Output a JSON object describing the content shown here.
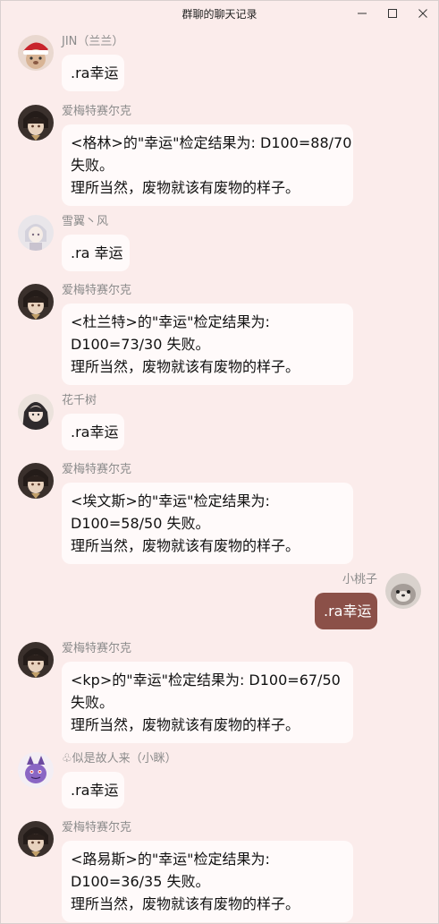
{
  "window": {
    "title": "群聊的聊天记录",
    "minimize_glyph": "—",
    "maximize_glyph": "☐",
    "close_glyph": "✕"
  },
  "messages": [
    {
      "sender": "JIN（兰兰）",
      "lines": [
        ".ra幸运"
      ],
      "side": "left",
      "avatar_icon": "santa-hat-avatar"
    },
    {
      "sender": "爱梅特赛尔克",
      "lines": [
        "<格林>的\"幸运\"检定结果为: D100=88/70",
        "失败。",
        "理所当然，废物就该有废物的样子。"
      ],
      "side": "left",
      "avatar_icon": "dark-character-avatar"
    },
    {
      "sender": "雪翼丶风",
      "lines": [
        ".ra 幸运"
      ],
      "side": "left",
      "avatar_icon": "light-character-avatar"
    },
    {
      "sender": "爱梅特赛尔克",
      "lines": [
        "<杜兰特>的\"幸运\"检定结果为:",
        "D100=73/30 失败。",
        "理所当然，废物就该有废物的样子。"
      ],
      "side": "left",
      "avatar_icon": "dark-character-avatar"
    },
    {
      "sender": "花千树",
      "lines": [
        ".ra幸运"
      ],
      "side": "left",
      "avatar_icon": "dark-hair-avatar"
    },
    {
      "sender": "爱梅特赛尔克",
      "lines": [
        "<埃文斯>的\"幸运\"检定结果为:",
        "D100=58/50 失败。",
        "理所当然，废物就该有废物的样子。"
      ],
      "side": "left",
      "avatar_icon": "dark-character-avatar"
    },
    {
      "sender": "小桃子",
      "lines": [
        ".ra幸运"
      ],
      "side": "right",
      "avatar_icon": "grey-pet-avatar"
    },
    {
      "sender": "爱梅特赛尔克",
      "lines": [
        "<kp>的\"幸运\"检定结果为: D100=67/50",
        "失败。",
        "理所当然，废物就该有废物的样子。"
      ],
      "side": "left",
      "avatar_icon": "dark-character-avatar"
    },
    {
      "sender": "♧似是故人来（小眯）",
      "lines": [
        ".ra幸运"
      ],
      "side": "left",
      "avatar_icon": "purple-creature-avatar"
    },
    {
      "sender": "爱梅特赛尔克",
      "lines": [
        "<路易斯>的\"幸运\"检定结果为:",
        "D100=36/35 失败。",
        "理所当然，废物就该有废物的样子。"
      ],
      "side": "left",
      "avatar_icon": "dark-character-avatar"
    }
  ],
  "colors": {
    "background": "#fbeceb",
    "bubble_left": "#fffafa",
    "bubble_right": "#8b5048",
    "sender_name": "#8c8c8c"
  }
}
